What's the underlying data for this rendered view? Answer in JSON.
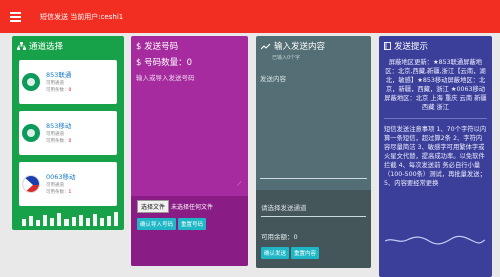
{
  "topbar": {
    "title": "短信发送 当前用户:ceshi1",
    "menu_icon": "menu-icon",
    "bg_color": "#f22d22"
  },
  "channel_card": {
    "title": "通道选择",
    "icon": "sitemap-icon",
    "items": [
      {
        "name": "853联通",
        "status": "可用通道",
        "balance_label": "可用条数：",
        "balance": "0",
        "icon": "macau-flag-icon"
      },
      {
        "name": "853移动",
        "status": "可用通道",
        "balance_label": "可用条数：",
        "balance": "0",
        "icon": "macau-flag-icon"
      },
      {
        "name": "0063移动",
        "status": "可用通道",
        "balance_label": "可用条数：",
        "balance": "1",
        "icon": "philippines-flag-icon"
      }
    ],
    "bar_levels": [
      0.5,
      0.7,
      0.45,
      0.8,
      0.6,
      0.9,
      0.5,
      0.65,
      0.75,
      0.55,
      0.85,
      0.6,
      0.7,
      1.0
    ],
    "bg_color": "#17a24a"
  },
  "number_card": {
    "title": "$ 发送号码",
    "count_label": "$ 号码数量：0",
    "placeholder": "输入或导入发送号码",
    "file_button": "选择文件",
    "file_status": "未选择任何文件",
    "import_button": "确认导入号码",
    "reset_button": "重置号码",
    "bg_color": "#a52b9e"
  },
  "content_card": {
    "title": "输入发送内容",
    "char_count": "已输入0个字",
    "placeholder": "发送内容",
    "channel_placeholder": "请选择发送通道",
    "remain_label": "可用余额：0",
    "send_button": "确认发送",
    "reset_button": "重置内容",
    "bg_color": "#546e75"
  },
  "tips_card": {
    "title": "发送提示",
    "tip1": "屏蔽地区更新：★853联通屏蔽地区：北京,西藏,新疆,浙江【云南，湖北，敏感】★853移动屏蔽地区：北京，新疆，西藏，浙江 ★0063移动屏蔽地区：北京 上海 重庆 云南 新疆 西藏 浙江",
    "tip2": "短信发送注意事项 1、70个字符以内算一条短信，超过算2条 2、字符内容尽量简洁 3、敏感字可用繁体字或火星文代替，提高成功率。以免软件拦截 4、每次发送前 务必自行小量（100-500条）测试，再批量发送；5、内容要经常更换",
    "bg_color": "#3b3f9a"
  }
}
